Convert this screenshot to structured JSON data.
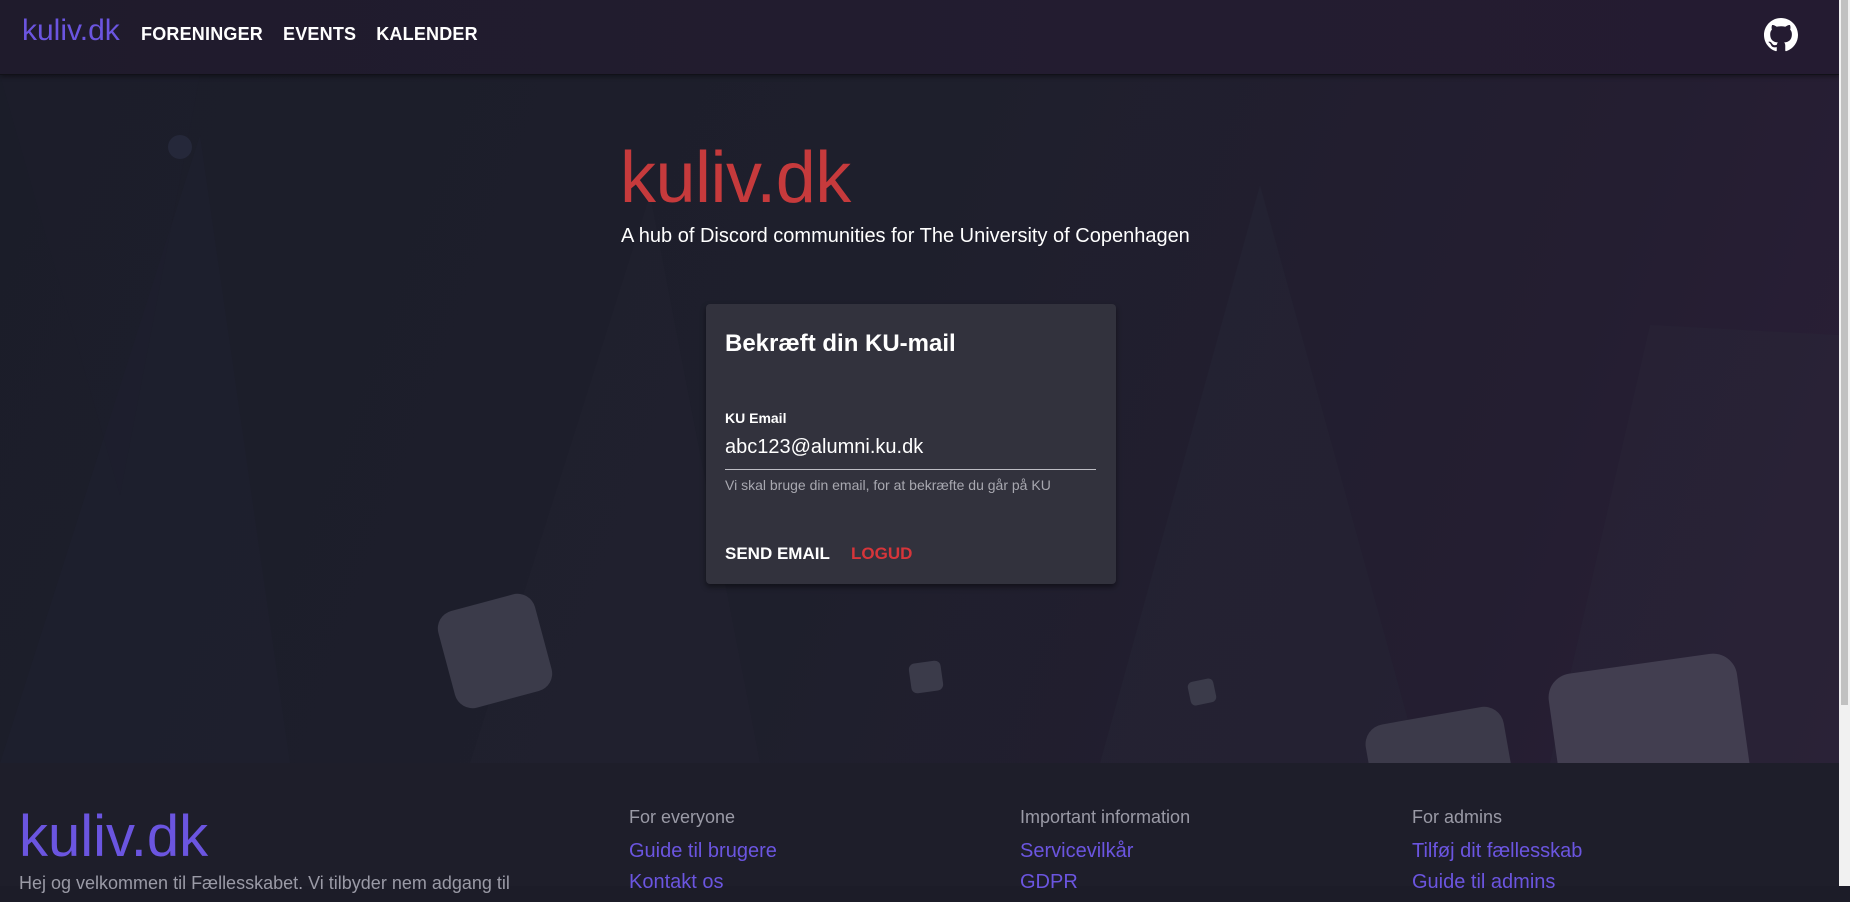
{
  "topbar": {
    "brand": "kuliv.dk",
    "nav": [
      "FORENINGER",
      "EVENTS",
      "KALENDER"
    ],
    "github_icon": "github-icon"
  },
  "hero": {
    "title": "kuliv.dk",
    "subtitle": "A hub of Discord communities for The University of Copenhagen"
  },
  "card": {
    "title": "Bekræft din KU-mail",
    "field_label": "KU Email",
    "field_value": "abc123@alumni.ku.dk",
    "field_help": "Vi skal bruge din email, for at bekræfte du går på KU",
    "send_label": "SEND EMAIL",
    "logout_label": "LOGUD"
  },
  "footer": {
    "brand": "kuliv.dk",
    "text": "Hej og velkommen til Fællesskabet. Vi tilbyder nem adgang til",
    "columns": [
      {
        "heading": "For everyone",
        "links": [
          "Guide til brugere",
          "Kontakt os"
        ]
      },
      {
        "heading": "Important information",
        "links": [
          "Servicevilkår",
          "GDPR"
        ]
      },
      {
        "heading": "For admins",
        "links": [
          "Tilføj dit fællesskab",
          "Guide til admins"
        ]
      }
    ]
  },
  "colors": {
    "accent": "#6b55e0",
    "hero_title": "#c63a3c",
    "logout": "#d7353a",
    "card_bg": "#32323d"
  }
}
